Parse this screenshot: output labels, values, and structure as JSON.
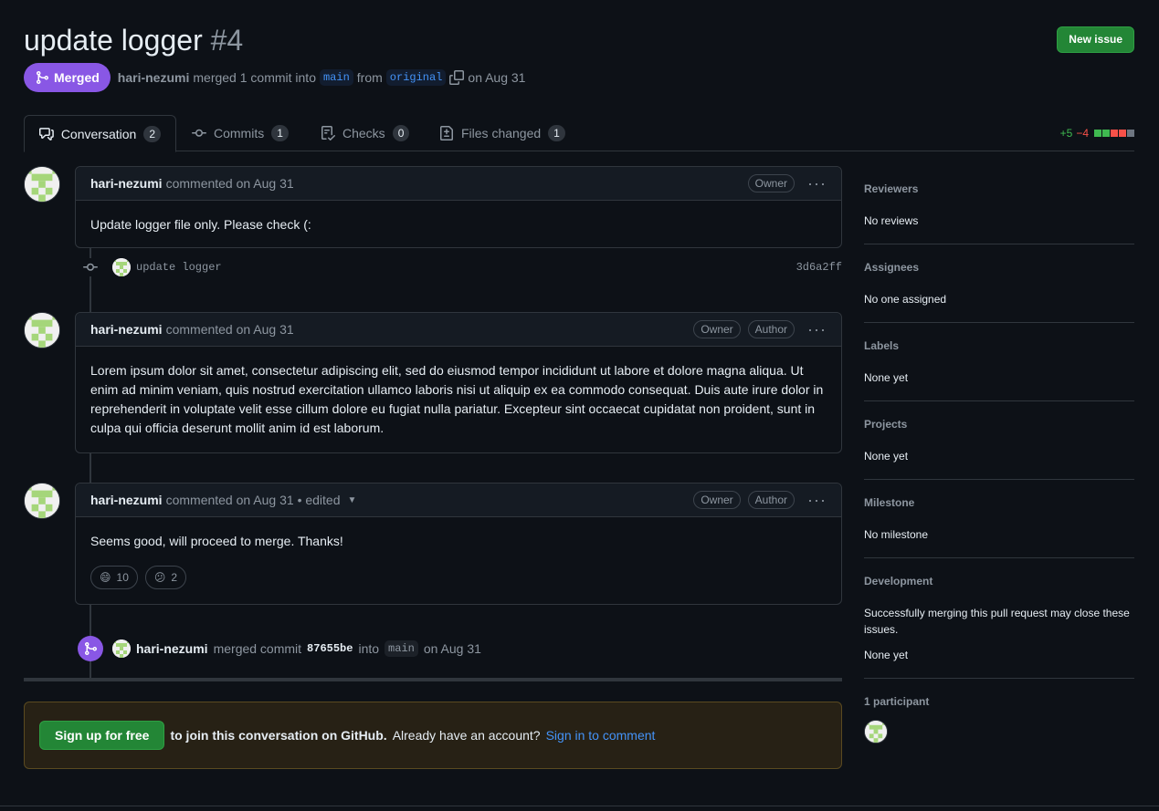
{
  "header": {
    "title": "update logger",
    "number": "#4",
    "new_issue_label": "New issue",
    "state_label": "Merged",
    "author": "hari-nezumi",
    "merge_text": "merged 1 commit into",
    "base_branch": "main",
    "from_text": "from",
    "head_branch": "original",
    "date_text": "on Aug 31"
  },
  "tabs": [
    {
      "label": "Conversation",
      "count": "2",
      "icon": "comment-discussion-icon"
    },
    {
      "label": "Commits",
      "count": "1",
      "icon": "git-commit-icon"
    },
    {
      "label": "Checks",
      "count": "0",
      "icon": "checklist-icon"
    },
    {
      "label": "Files changed",
      "count": "1",
      "icon": "file-diff-icon"
    }
  ],
  "diffstat": {
    "additions": "+5",
    "deletions": "−4",
    "colors": [
      "#3fb950",
      "#3fb950",
      "#f85149",
      "#f85149",
      "#6e7681"
    ]
  },
  "comments": [
    {
      "author": "hari-nezumi",
      "meta": "commented on Aug 31",
      "badges": [
        "Owner"
      ],
      "body": "Update logger file only. Please check (:"
    },
    {
      "author": "hari-nezumi",
      "meta": "commented on Aug 31",
      "badges": [
        "Owner",
        "Author"
      ],
      "body": "Lorem ipsum dolor sit amet, consectetur adipiscing elit, sed do eiusmod tempor incididunt ut labore et dolore magna aliqua. Ut enim ad minim veniam, quis nostrud exercitation ullamco laboris nisi ut aliquip ex ea commodo consequat. Duis aute irure dolor in reprehenderit in voluptate velit esse cillum dolore eu fugiat nulla pariatur. Excepteur sint occaecat cupidatat non proident, sunt in culpa qui officia deserunt mollit anim id est laborum."
    },
    {
      "author": "hari-nezumi",
      "meta": "commented on Aug 31 • edited",
      "badges": [
        "Owner",
        "Author"
      ],
      "body": "Seems good, will proceed to merge. Thanks!",
      "reactions": [
        {
          "emoji": "😄",
          "count": "10"
        },
        {
          "emoji": "😕",
          "count": "2"
        }
      ]
    }
  ],
  "commit": {
    "message": "update logger",
    "sha": "3d6a2ff"
  },
  "merge_event": {
    "author": "hari-nezumi",
    "text1": "merged commit",
    "sha": "87655be",
    "text2": "into",
    "branch": "main",
    "date": "on Aug 31"
  },
  "signup": {
    "button": "Sign up for free",
    "text_bold": "to join this conversation on GitHub.",
    "text": "Already have an account?",
    "link": "Sign in to comment"
  },
  "sidebar": [
    {
      "title": "Reviewers",
      "value": "No reviews"
    },
    {
      "title": "Assignees",
      "value": "No one assigned"
    },
    {
      "title": "Labels",
      "value": "None yet"
    },
    {
      "title": "Projects",
      "value": "None yet"
    },
    {
      "title": "Milestone",
      "value": "No milestone"
    },
    {
      "title": "Development",
      "value": "Successfully merging this pull request may close these issues.",
      "value2": "None yet"
    },
    {
      "title": "1 participant"
    }
  ]
}
